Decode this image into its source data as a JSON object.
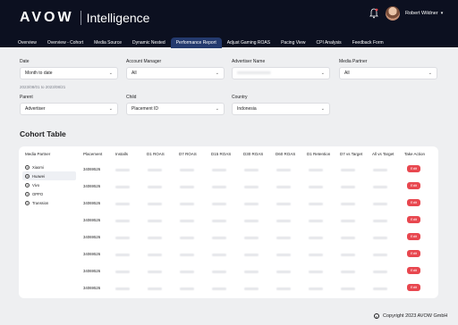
{
  "header": {
    "brand": "AVOW",
    "product": "Intelligence",
    "user_name": "Robert Wildner"
  },
  "tabs": [
    {
      "label": "Overview",
      "active": false
    },
    {
      "label": "Overview - Cohort",
      "active": false
    },
    {
      "label": "Media Source",
      "active": false
    },
    {
      "label": "Dynamic Nested",
      "active": false
    },
    {
      "label": "Performance Report",
      "active": true
    },
    {
      "label": "Adjust Gaming ROAS",
      "active": false
    },
    {
      "label": "Pacing View",
      "active": false
    },
    {
      "label": "CPI Analysis",
      "active": false
    },
    {
      "label": "Feedback Form",
      "active": false
    }
  ],
  "filters": {
    "date_label": "Date",
    "date_value": "Month to date",
    "date_range": "2023/08/01 to 2023/08/21",
    "account_manager_label": "Account Manager",
    "account_manager_value": "All",
    "advertiser_name_label": "Advertiser Name",
    "advertiser_name_value": "xxxxxxxxxxxxxxx",
    "media_partner_label": "Media Partner",
    "media_partner_value": "All",
    "parent_label": "Parent",
    "parent_value": "Advertiser",
    "child_label": "Child",
    "child_value": "Placement ID",
    "country_label": "Country",
    "country_value": "Indonesia"
  },
  "cohort": {
    "title": "Cohort Table",
    "media_partner_header": "Media Partner",
    "media_partners": [
      {
        "name": "Xiaomi",
        "selected": false
      },
      {
        "name": "Huawei",
        "selected": true
      },
      {
        "name": "Vivo",
        "selected": false
      },
      {
        "name": "OPPO",
        "selected": false
      },
      {
        "name": "Transsion",
        "selected": false
      }
    ],
    "columns": [
      "Placement",
      "Installs",
      "D1 ROAS",
      "D7 ROAS",
      "D15 ROAS",
      "D30 ROAS",
      "D60 ROAS",
      "D1 Retention",
      "D7 vs Target",
      "All vs Target",
      "Take Action"
    ],
    "rows": [
      {
        "placement": "34069526",
        "action": "Edit"
      },
      {
        "placement": "34069526",
        "action": "Edit"
      },
      {
        "placement": "34069526",
        "action": "Edit"
      },
      {
        "placement": "34069526",
        "action": "Edit"
      },
      {
        "placement": "34069526",
        "action": "Edit"
      },
      {
        "placement": "34069526",
        "action": "Edit"
      },
      {
        "placement": "34069526",
        "action": "Edit"
      },
      {
        "placement": "34069526",
        "action": "Edit"
      }
    ]
  },
  "footer": {
    "copyright": "Copyright 2023 AVOW GmbH"
  },
  "colors": {
    "topbar": "#0c1020",
    "active_tab": "#243a6e",
    "edit_button": "#e8474f",
    "background": "#eeeff1"
  }
}
